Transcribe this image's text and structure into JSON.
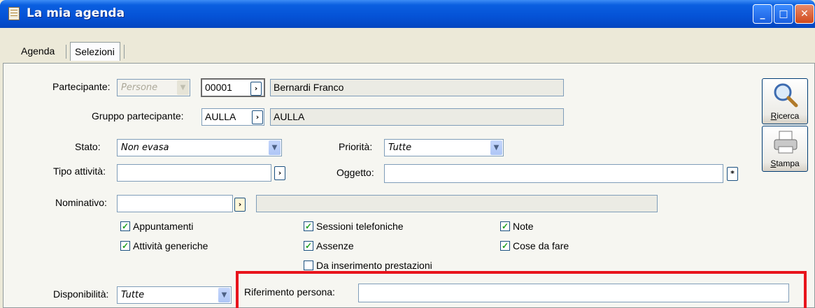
{
  "window": {
    "title": "La mia agenda"
  },
  "tabs": [
    {
      "label": "Agenda"
    },
    {
      "label": "Selezioni"
    }
  ],
  "form": {
    "partecipante": {
      "label": "Partecipante:",
      "type_value": "Persone",
      "code": "00001",
      "name": "Bernardi Franco"
    },
    "gruppo": {
      "label": "Gruppo partecipante:",
      "code": "AULLA",
      "name": "AULLA"
    },
    "stato": {
      "label": "Stato:",
      "value": "Non evasa"
    },
    "priorita": {
      "label": "Priorità:",
      "value": "Tutte"
    },
    "tipo_attivita": {
      "label": "Tipo attività:",
      "value": ""
    },
    "oggetto": {
      "label": "Oggetto:",
      "value": ""
    },
    "nominativo": {
      "label": "Nominativo:",
      "value": "",
      "desc": ""
    },
    "checkboxes": [
      {
        "label": "Appuntamenti",
        "checked": true
      },
      {
        "label": "Sessioni telefoniche",
        "checked": true
      },
      {
        "label": "Note",
        "checked": true
      },
      {
        "label": "Attività generiche",
        "checked": true
      },
      {
        "label": "Assenze",
        "checked": true
      },
      {
        "label": "Cose da fare",
        "checked": true
      },
      {
        "label": "Da inserimento prestazioni",
        "checked": false
      }
    ],
    "disponibilita": {
      "label": "Disponibilità:",
      "value": "Tutte"
    },
    "riferimento": {
      "label": "Riferimento persona:",
      "value": ""
    }
  },
  "buttons": {
    "ricerca_hot": "R",
    "ricerca_rest": "icerca",
    "stampa_hot": "S",
    "stampa_rest": "tampa"
  },
  "glyphs": {
    "zoom": "›",
    "combo": "▼",
    "check": "✓",
    "minimize": "_",
    "maximize": "□",
    "close": "✕",
    "star": "*"
  },
  "colors": {
    "title_bar": "#0552d6",
    "highlight": "#e8141c",
    "check": "#21a121"
  }
}
